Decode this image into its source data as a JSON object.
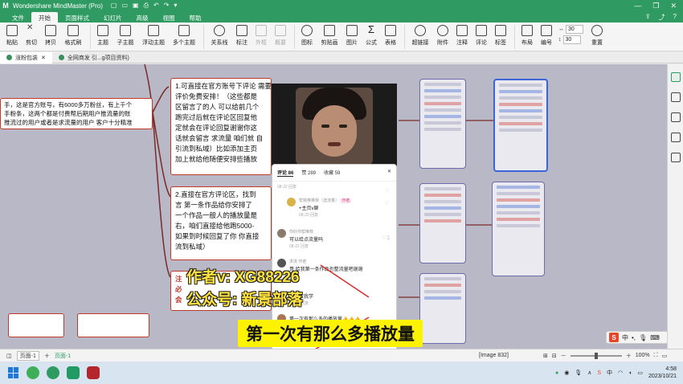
{
  "window": {
    "title": "Wondershare MindMaster (Pro)",
    "logo": "M"
  },
  "menu": {
    "tabs": [
      "文件",
      "开始",
      "页面样式",
      "幻灯片",
      "高级",
      "视图",
      "帮助"
    ],
    "active_index": 1
  },
  "ribbon": {
    "buttons": [
      {
        "label": "粘贴",
        "icon": "paste-icon"
      },
      {
        "label": "剪切",
        "icon": "cut-icon"
      },
      {
        "label": "拷贝",
        "icon": "copy-icon"
      },
      {
        "label": "格式刷",
        "icon": "format-painter-icon"
      },
      {
        "label": "主题",
        "icon": "topic-icon"
      },
      {
        "label": "子主题",
        "icon": "subtopic-icon"
      },
      {
        "label": "浮动主题",
        "icon": "floating-topic-icon"
      },
      {
        "label": "多个主题",
        "icon": "multiple-topics-icon"
      },
      {
        "label": "关系线",
        "icon": "relationship-icon"
      },
      {
        "label": "标注",
        "icon": "callout-icon"
      },
      {
        "label": "外框",
        "icon": "boundary-icon"
      },
      {
        "label": "概要",
        "icon": "summary-icon"
      },
      {
        "label": "图标",
        "icon": "icon-icon"
      },
      {
        "label": "剪贴画",
        "icon": "clipart-icon"
      },
      {
        "label": "图片",
        "icon": "image-icon"
      },
      {
        "label": "公式",
        "icon": "formula-icon"
      },
      {
        "label": "表格",
        "icon": "table-icon"
      },
      {
        "label": "超链接",
        "icon": "hyperlink-icon"
      },
      {
        "label": "附件",
        "icon": "attachment-icon"
      },
      {
        "label": "注释",
        "icon": "note-icon"
      },
      {
        "label": "评论",
        "icon": "comment-icon"
      },
      {
        "label": "标签",
        "icon": "tag-icon"
      },
      {
        "label": "布局",
        "icon": "layout-icon"
      },
      {
        "label": "编号",
        "icon": "numbering-icon"
      },
      {
        "label": "重置",
        "icon": "reset-icon"
      }
    ],
    "spacing_top": "30",
    "spacing_bottom": "30"
  },
  "doc_tabs": [
    {
      "label": "涨粉包装"
    },
    {
      "label": "全网商发 引...g项目资料)"
    }
  ],
  "mindmap": {
    "left_node": "手，这是官方账号，有6000多万粉丝，有上千个\n手粉条，这两个都是付费帮后期用户推流量的账\n推流过的用户或者是求流量的用户 客户十分精准",
    "node1": "1.可直接在官方账号下评论 需要帮推，直播 小编就给你\n评价免费安排！（这些都是\n区留言了的人 可以给前几个\n跑完过后就在评论区回复他\n定就会在评论回复谢谢你这\n话就会留言 求流量 咱们就 自\n引流到私域）比如添加主页\n加上就给他随便安排些播放",
    "node2": "2.直接在官方评论区，找到\n言 第一条作品给你安排了\n一个作品一般人的播放量是\n右，咱们直接给他跑5000-\n如果到时候回复了你 你直接\n流到私域）",
    "node3": "注\n必\n会",
    "bottom_left_1": "",
    "bottom_left_2": ""
  },
  "comments": {
    "tabs": [
      "评论 86",
      "赞 289",
      "收藏 59"
    ],
    "items": [
      {
        "name": "",
        "text": "",
        "meta": "08-22  回复"
      },
      {
        "name": "帮我推推我（送流量）",
        "tag": "作者",
        "text": "+主页v聊",
        "meta": "08-22  回复"
      },
      {
        "name": "你好你帮推荐",
        "text": "可以给点流量吗",
        "meta": "08-22  回复",
        "likes": "1"
      },
      {
        "name": "求流 作者",
        "text": "哥 给我第一条作品也整流量吧谢谢",
        "meta": ""
      },
      {
        "name": "",
        "text": "哥，教我学",
        "meta": "08-22  回复"
      },
      {
        "name": "",
        "text": "第一次有那么多的播放量👍👍👍",
        "meta": ""
      }
    ]
  },
  "overlays": {
    "watermark_1": "作者v: XG88226",
    "watermark_2": "公众号: 新景部落",
    "subtitle": "第一次有那么多播放量"
  },
  "ime": {
    "logo": "S",
    "lang": "中"
  },
  "statusbar": {
    "page_select": "页面-1",
    "current_page": "页面-1",
    "image_ref": "[Image 832]",
    "zoom": "100%"
  },
  "taskbar": {
    "time": "4:58",
    "date": "2023/10/21"
  }
}
